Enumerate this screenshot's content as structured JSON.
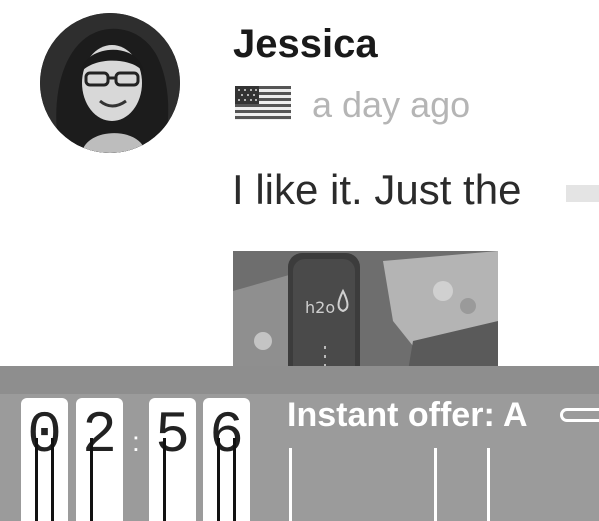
{
  "review": {
    "author": "Jessica",
    "country_flag": "us-flag-icon",
    "time_ago": "a day ago",
    "text": "I like it. Just the"
  },
  "offer_bar": {
    "timer_digits": [
      "0",
      "2",
      "5",
      "6"
    ],
    "separator": ":",
    "text": "Instant offer: A"
  },
  "colors": {
    "name_text": "#1a1a1a",
    "muted_text": "#b5b5b5",
    "offer_bar_bg": "#9b9b9b",
    "offer_text": "#ffffff"
  }
}
